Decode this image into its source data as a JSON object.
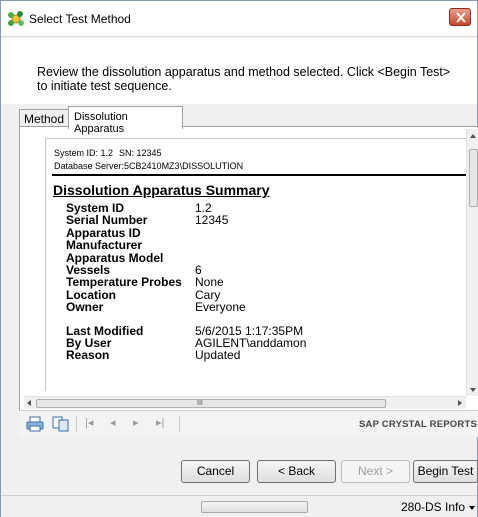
{
  "window": {
    "title": "Select Test Method",
    "instructions": "Review the dissolution apparatus and method selected. Click <Begin Test> to initiate test sequence."
  },
  "tabs": [
    {
      "label": "Method"
    },
    {
      "label": "Dissolution Apparatus"
    }
  ],
  "report": {
    "system_id_line": "System ID: 1.2",
    "sn_line": "SN: 12345",
    "db_line": "Database Server:5CB2410MZ3\\DISSOLUTION",
    "heading": "Dissolution Apparatus Summary",
    "fields": [
      {
        "label": "System ID",
        "value": "1.2"
      },
      {
        "label": "Serial Number",
        "value": "12345"
      },
      {
        "label": "Apparatus ID",
        "value": ""
      },
      {
        "label": "Manufacturer",
        "value": ""
      },
      {
        "label": "Apparatus Model",
        "value": ""
      },
      {
        "label": "Vessels",
        "value": "6"
      },
      {
        "label": "Temperature Probes",
        "value": "None"
      },
      {
        "label": "Location",
        "value": "Cary"
      },
      {
        "label": "Owner",
        "value": "Everyone"
      }
    ],
    "fields2": [
      {
        "label": "Last Modified",
        "value": "5/6/2015   1:17:35PM"
      },
      {
        "label": "By User",
        "value": "AGILENT\\anddamon"
      },
      {
        "label": "Reason",
        "value": "Updated"
      }
    ]
  },
  "toolbar": {
    "brand": "SAP CRYSTAL REPORTS",
    "icons": [
      "print-icon",
      "export-icon",
      "first-page-icon",
      "previous-page-icon",
      "next-page-icon",
      "last-page-icon"
    ]
  },
  "buttons": {
    "cancel": "Cancel",
    "back": "< Back",
    "next": "Next >",
    "begin": "Begin Test"
  },
  "statusbar": {
    "info": "280-DS Info"
  },
  "colors": {
    "close_button": "#c8462e",
    "window_bg": "#f0f0f0"
  }
}
